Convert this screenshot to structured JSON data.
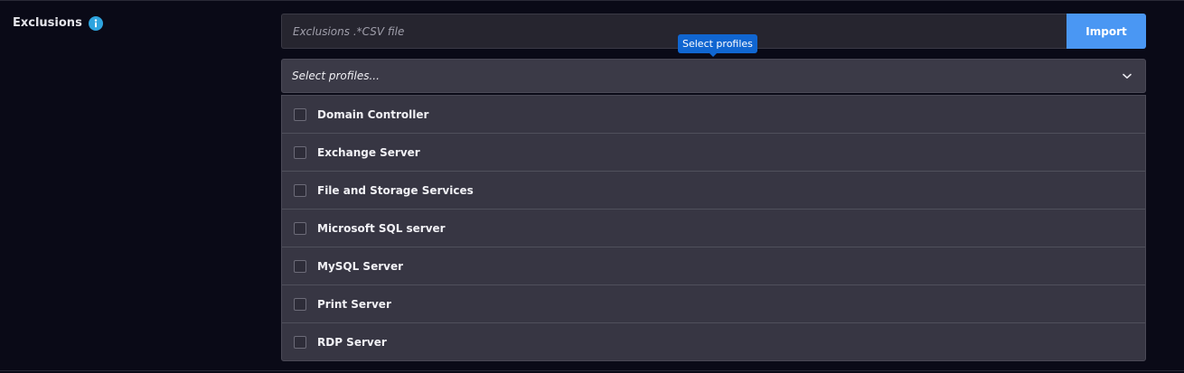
{
  "section": {
    "label": "Exclusions",
    "info_icon": "info-icon"
  },
  "file_input": {
    "placeholder": "Exclusions .*CSV file"
  },
  "import_button": {
    "label": "Import"
  },
  "tooltip": {
    "text": "Select profiles"
  },
  "profile_select": {
    "placeholder": "Select profiles...",
    "icon": "chevron-down-icon",
    "options": [
      {
        "label": "Domain Controller",
        "checked": false
      },
      {
        "label": "Exchange Server",
        "checked": false
      },
      {
        "label": "File and Storage Services",
        "checked": false
      },
      {
        "label": "Microsoft SQL server",
        "checked": false
      },
      {
        "label": "MySQL Server",
        "checked": false
      },
      {
        "label": "Print Server",
        "checked": false
      },
      {
        "label": "RDP Server",
        "checked": false
      }
    ]
  },
  "colors": {
    "background": "#0a0a17",
    "accent_button": "#4a97f3",
    "tooltip": "#1066d1",
    "info_icon": "#2ea4df"
  }
}
